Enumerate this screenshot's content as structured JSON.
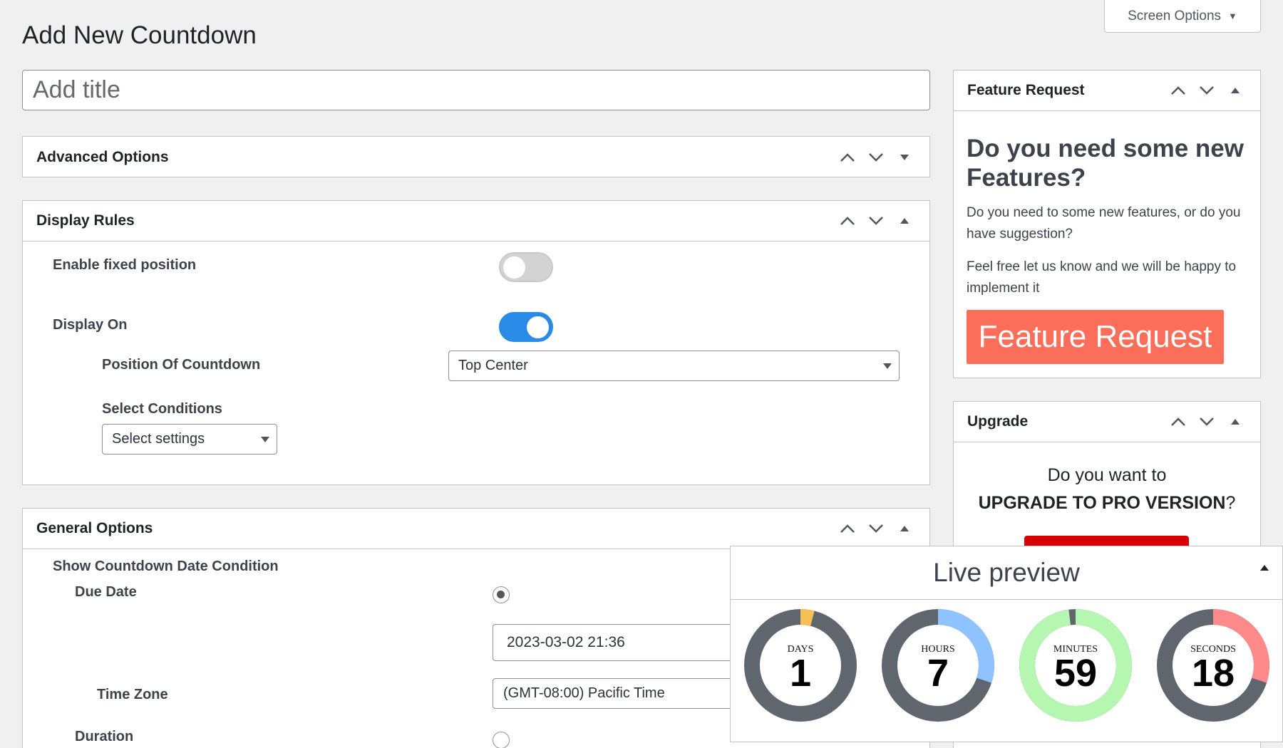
{
  "screen_options": {
    "label": "Screen Options"
  },
  "page": {
    "title": "Add New Countdown"
  },
  "title_input": {
    "placeholder": "Add title"
  },
  "advanced_options": {
    "title": "Advanced Options"
  },
  "display_rules": {
    "title": "Display Rules",
    "enable_fixed_position": {
      "label": "Enable fixed position",
      "enabled": false
    },
    "display_on": {
      "label": "Display On",
      "enabled": true
    },
    "position_of_countdown": {
      "label": "Position Of Countdown",
      "value": "Top Center"
    },
    "select_conditions": {
      "label": "Select Conditions",
      "value": "Select settings"
    }
  },
  "general_options": {
    "title": "General Options",
    "show_condition_label": "Show Countdown Date Condition",
    "due_date": {
      "label": "Due Date",
      "selected": true,
      "value": "2023-03-02 21:36"
    },
    "time_zone": {
      "label": "Time Zone",
      "value": "(GMT-08:00) Pacific Time"
    },
    "duration": {
      "label": "Duration",
      "selected": false
    }
  },
  "feature_request": {
    "title": "Feature Request",
    "heading": "Do you need some new Features?",
    "text1": "Do you need to some new features, or do you have suggestion?",
    "text2": "Feel free let us know and we will be happy to implement it",
    "button_label": "Feature Request",
    "button_color": "#fa6e5a"
  },
  "upgrade": {
    "title": "Upgrade",
    "question_line1": "Do you want to",
    "question_strong": "UPGRADE TO PRO VERSION",
    "question_end": "?"
  },
  "live_preview": {
    "title": "Live preview",
    "timers": [
      {
        "label": "DAYS",
        "value": "1",
        "progress": 0.04,
        "color": "#f5c156",
        "track": "#5f666d"
      },
      {
        "label": "HOURS",
        "value": "7",
        "progress": 0.3,
        "color": "#8ec3ff",
        "track": "#5f666d"
      },
      {
        "label": "MINUTES",
        "value": "59",
        "progress": 0.98,
        "color": "#b5f7b0",
        "track": "#5f666d"
      },
      {
        "label": "SECONDS",
        "value": "18",
        "progress": 0.3,
        "color": "#ff8a8a",
        "track": "#5f666d"
      }
    ]
  },
  "colors": {
    "toggle_on": "#2a8ae8",
    "accent_red": "#d60000"
  }
}
